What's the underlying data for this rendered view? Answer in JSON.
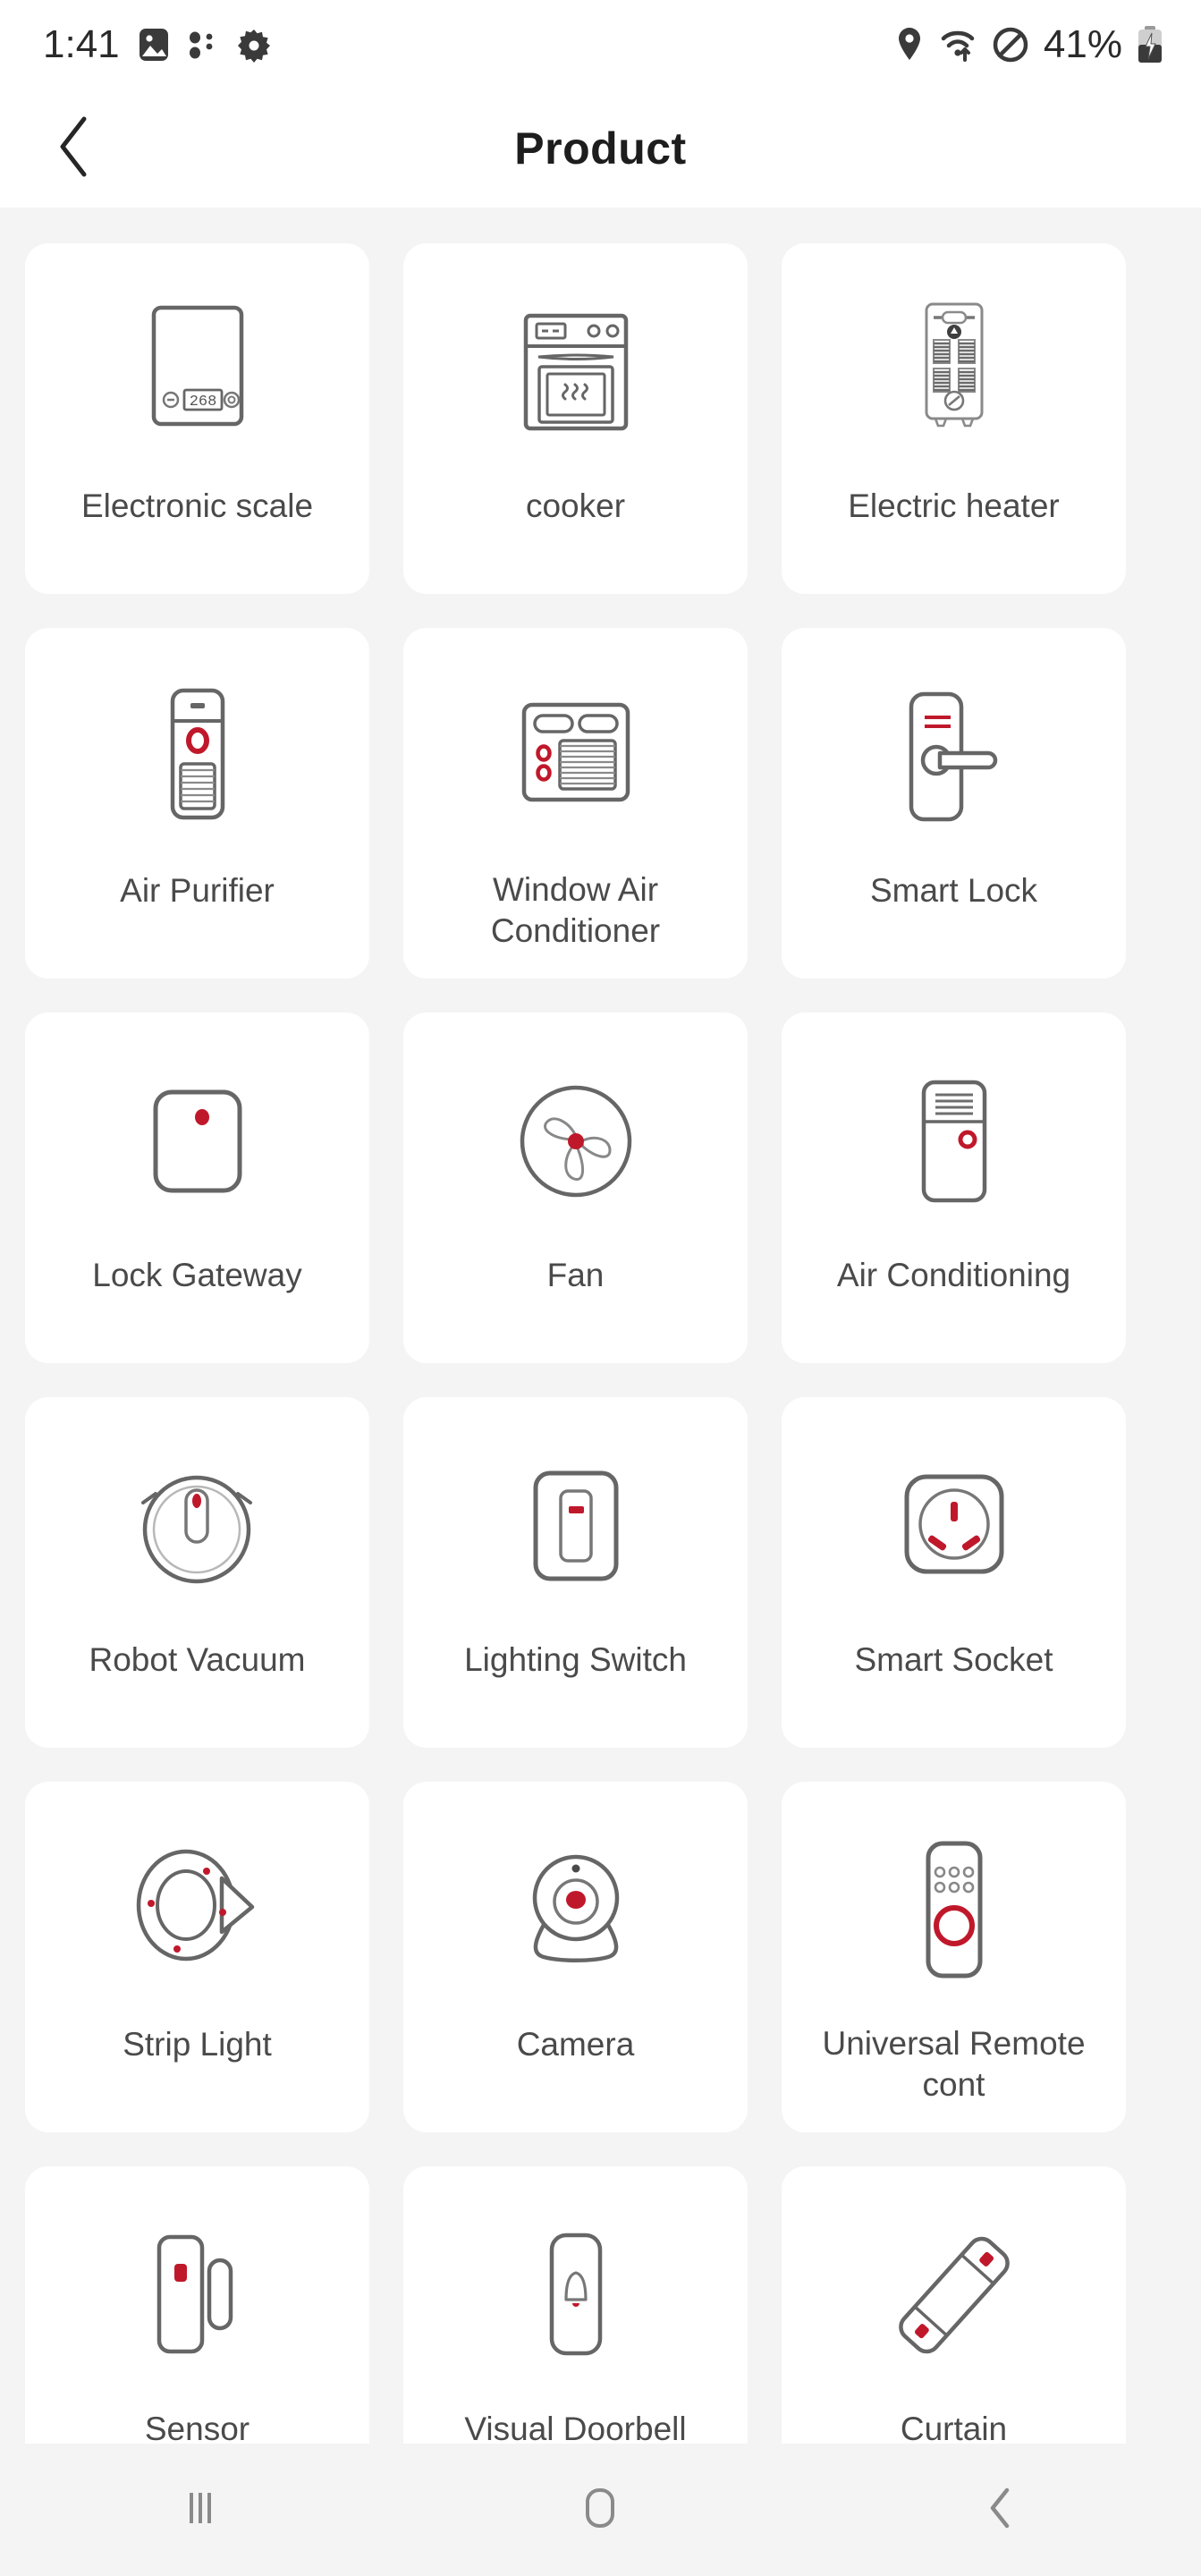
{
  "status_bar": {
    "time": "1:41",
    "battery_percent": "41%",
    "left_icons": [
      "gallery-icon",
      "bluetooth-dots-icon",
      "gear-icon"
    ],
    "right_icons": [
      "location-pin-icon",
      "wifi-icon",
      "do-not-disturb-icon",
      "battery-charging-icon"
    ]
  },
  "header": {
    "title": "Product",
    "back_icon": "chevron-left-icon"
  },
  "theme": {
    "accent_red": "#C0182B",
    "icon_stroke": "#666666",
    "page_background": "#f4f4f4",
    "card_background": "#ffffff",
    "label_color": "#4a4a4a"
  },
  "products": [
    {
      "label": "Electronic scale",
      "icon": "electronic-scale-icon",
      "display_value": "268"
    },
    {
      "label": "cooker",
      "icon": "cooker-icon"
    },
    {
      "label": "Electric heater",
      "icon": "electric-heater-icon"
    },
    {
      "label": "Air Purifier",
      "icon": "air-purifier-icon"
    },
    {
      "label": "Window Air Conditioner",
      "icon": "window-air-conditioner-icon"
    },
    {
      "label": "Smart Lock",
      "icon": "smart-lock-icon"
    },
    {
      "label": "Lock Gateway",
      "icon": "lock-gateway-icon"
    },
    {
      "label": "Fan",
      "icon": "fan-icon"
    },
    {
      "label": "Air Conditioning",
      "icon": "air-conditioning-icon"
    },
    {
      "label": "Robot Vacuum",
      "icon": "robot-vacuum-icon"
    },
    {
      "label": "Lighting Switch",
      "icon": "lighting-switch-icon"
    },
    {
      "label": "Smart Socket",
      "icon": "smart-socket-icon"
    },
    {
      "label": "Strip Light",
      "icon": "strip-light-icon"
    },
    {
      "label": "Camera",
      "icon": "camera-icon"
    },
    {
      "label": "Universal Remote cont",
      "icon": "universal-remote-icon"
    },
    {
      "label": "Sensor",
      "icon": "door-window-sensor-icon"
    },
    {
      "label": "Visual Doorbell",
      "icon": "visual-doorbell-icon"
    },
    {
      "label": "Curtain",
      "icon": "curtain-motor-icon"
    }
  ],
  "nav_bar": {
    "recents_icon": "recents-icon",
    "home_icon": "home-icon",
    "back_icon": "back-chevron-icon"
  }
}
